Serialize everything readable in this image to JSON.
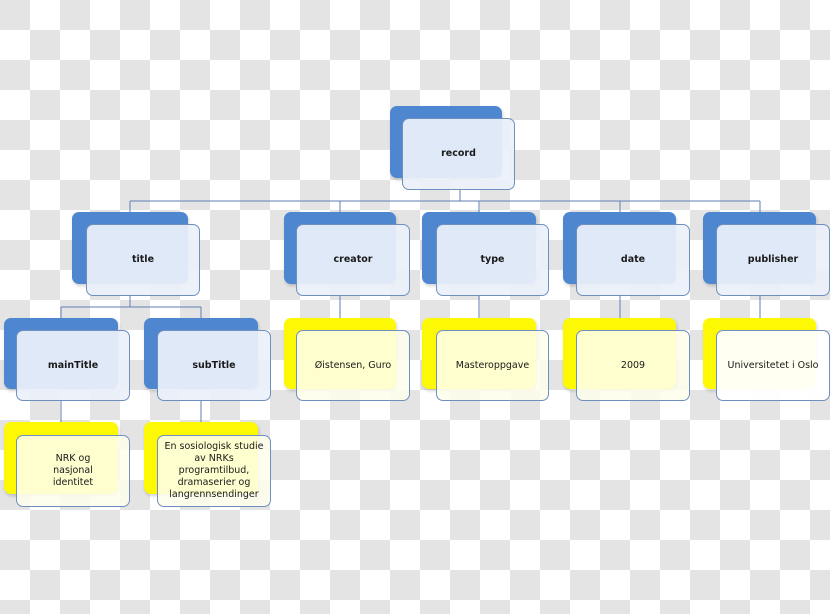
{
  "diagram": {
    "type": "hierarchy",
    "colors": {
      "level_node": "#4f86d0",
      "value_node": "#fdf904",
      "connector": "#5f7fb3",
      "node_border": "#6f8fbf"
    },
    "root": {
      "label": "record"
    },
    "fields": {
      "title": {
        "label": "title"
      },
      "mainTitle": {
        "label": "mainTitle",
        "value": "NRK og nasjonal identitet"
      },
      "subTitle": {
        "label": "subTitle",
        "value": "En sosiologisk studie av NRKs programtilbud, dramaserier og langrennsendinger"
      },
      "creator": {
        "label": "creator",
        "value": "Øistensen, Guro"
      },
      "type": {
        "label": "type",
        "value": "Masteroppgave"
      },
      "date": {
        "label": "date",
        "value": "2009"
      },
      "publisher": {
        "label": "publisher",
        "value": "Universitetet i Oslo"
      }
    }
  }
}
